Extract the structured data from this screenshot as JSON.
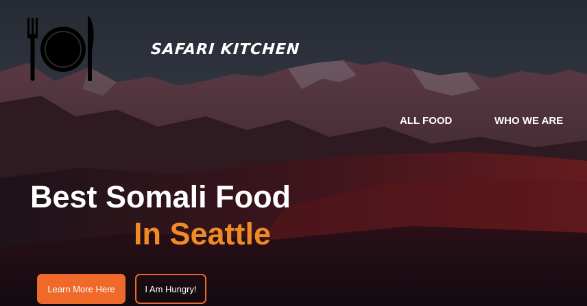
{
  "brand": {
    "name": "SAFARI KITCHEN",
    "logo_icon": "plate-fork-knife-icon"
  },
  "nav": {
    "items": [
      {
        "label": "ALL FOOD"
      },
      {
        "label": "WHO WE ARE"
      }
    ]
  },
  "hero": {
    "headline": "Best Somali Food",
    "subheadline": "In Seattle",
    "background": "mountain-landscape-night"
  },
  "buttons": {
    "primary_label": "Learn More Here",
    "secondary_label": "I Am Hungry!"
  },
  "colors": {
    "accent": "#f08a24",
    "button": "#ef6a2a",
    "text": "#ffffff",
    "sky": "#2b2f3a"
  }
}
